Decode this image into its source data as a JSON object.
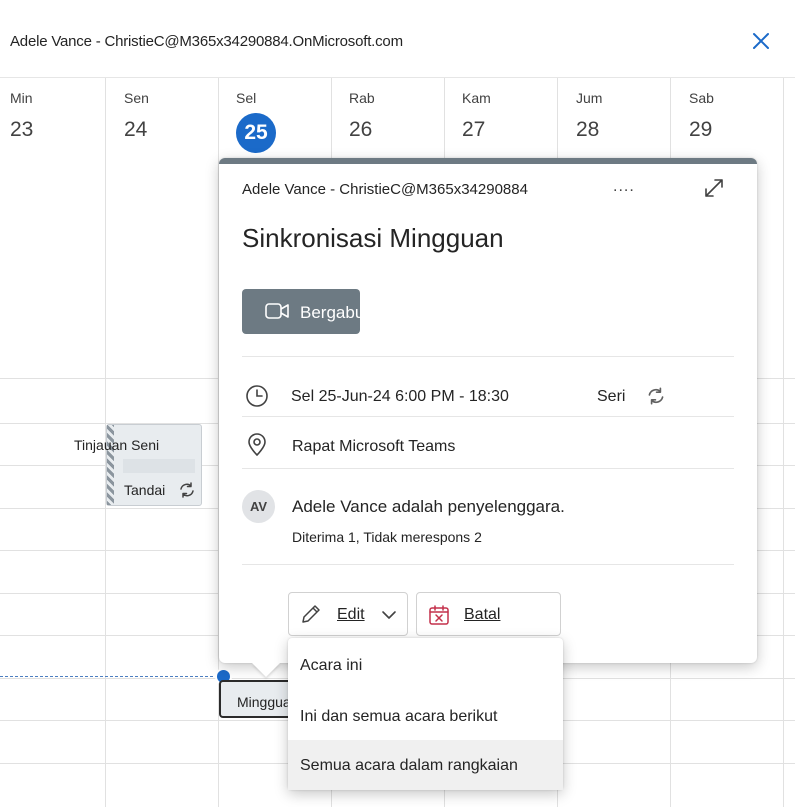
{
  "window": {
    "title": "Adele Vance - ChristieC@M365x34290884.OnMicrosoft.com"
  },
  "week": {
    "days": [
      {
        "name": "Min",
        "num": "23"
      },
      {
        "name": "Sen",
        "num": "24"
      },
      {
        "name": "Sel",
        "num": "25"
      },
      {
        "name": "Rab",
        "num": "26"
      },
      {
        "name": "Kam",
        "num": "27"
      },
      {
        "name": "Jum",
        "num": "28"
      },
      {
        "name": "Sab",
        "num": "29"
      }
    ]
  },
  "calendar_events": {
    "art_review": {
      "title": "Tinjauan Seni",
      "tag": "Tandai"
    },
    "weekly_selected": {
      "title": "Mingguan"
    }
  },
  "popup": {
    "organizer_line": "Adele Vance - ChristieC@M365x34290884",
    "more_label": "....",
    "title": "Sinkronisasi Mingguan",
    "join_label": "Bergabung",
    "datetime": "Sel 25-Jun-24 6:00 PM - 18:30",
    "series_label": "Seri",
    "location": "Rapat Microsoft Teams",
    "avatar_initials": "AV",
    "organizer_text": "Adele Vance adalah penyelenggara.",
    "responses": "Diterima 1, Tidak merespons 2",
    "edit_label": "Edit",
    "cancel_label": "Batal"
  },
  "edit_menu": {
    "items": [
      {
        "label": "Acara ini"
      },
      {
        "label": "Ini dan semua acara berikut"
      },
      {
        "label": "Semua acara dalam rangkaian"
      }
    ]
  },
  "colors": {
    "accent": "#1b6ac9",
    "event_band": "#6d7a83",
    "cancel_red": "#c4314b"
  }
}
